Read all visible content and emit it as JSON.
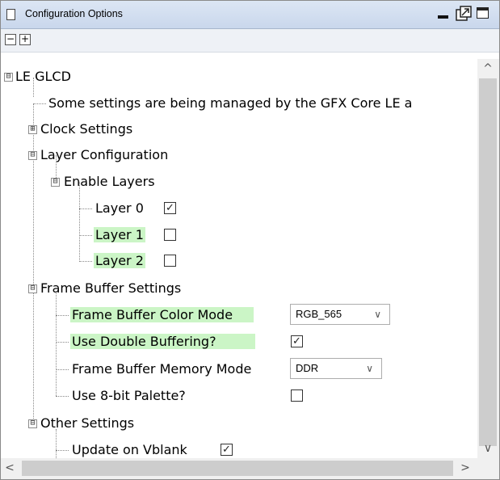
{
  "window": {
    "title": "Configuration Options"
  },
  "toolbar": {
    "collapse_glyph": "−",
    "expand_glyph": "+"
  },
  "tree": {
    "root": "LE GLCD",
    "managed_note": "Some settings are being managed by the GFX Core LE a",
    "clock_settings": "Clock Settings",
    "layer_configuration": "Layer Configuration",
    "enable_layers": "Enable Layers",
    "layers": [
      {
        "label": "Layer 0",
        "checked": true,
        "highlighted": false
      },
      {
        "label": "Layer 1",
        "checked": false,
        "highlighted": true
      },
      {
        "label": "Layer 2",
        "checked": false,
        "highlighted": true
      }
    ],
    "frame_buffer_settings": "Frame Buffer Settings",
    "fb_color_mode": {
      "label": "Frame Buffer Color Mode",
      "value": "RGB_565"
    },
    "double_buffering": {
      "label": "Use Double Buffering?",
      "checked": true
    },
    "fb_memory_mode": {
      "label": "Frame Buffer Memory Mode",
      "value": "DDR"
    },
    "palette_8bit": {
      "label": "Use 8-bit Palette?",
      "checked": false
    },
    "other_settings": "Other Settings",
    "update_vblank": {
      "label": "Update on Vblank",
      "checked": true
    }
  },
  "icons": {
    "expanded": "⊟",
    "collapsed": "⊞",
    "check_mark": "✓",
    "dropdown": "∨",
    "scroll_up": "^",
    "scroll_down": "∨",
    "scroll_left": "<",
    "scroll_right": ">"
  },
  "colors": {
    "highlight": "#cbf5c6",
    "titlebar": "#dce6f4"
  }
}
